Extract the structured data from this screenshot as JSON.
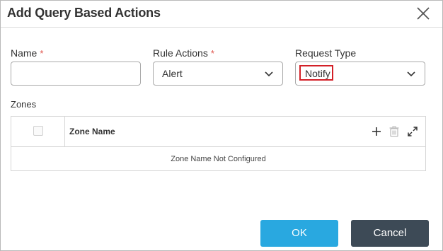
{
  "dialog": {
    "title": "Add Query Based Actions"
  },
  "fields": {
    "name": {
      "label": "Name",
      "required_mark": "*",
      "value": "",
      "placeholder": ""
    },
    "rule_actions": {
      "label": "Rule Actions",
      "required_mark": "*",
      "selected": "Alert"
    },
    "request_type": {
      "label": "Request Type",
      "selected": "Notify",
      "highlight_color": "#d32027"
    }
  },
  "zones": {
    "label": "Zones",
    "column_header": "Zone Name",
    "empty_message": "Zone Name Not Configured",
    "icons": [
      "plus-icon",
      "trash-icon",
      "expand-icon"
    ]
  },
  "buttons": {
    "ok": "OK",
    "cancel": "Cancel"
  },
  "colors": {
    "ok_button": "#29a8e0",
    "cancel_button": "#3d4a56",
    "required_asterisk": "#e0554d"
  }
}
